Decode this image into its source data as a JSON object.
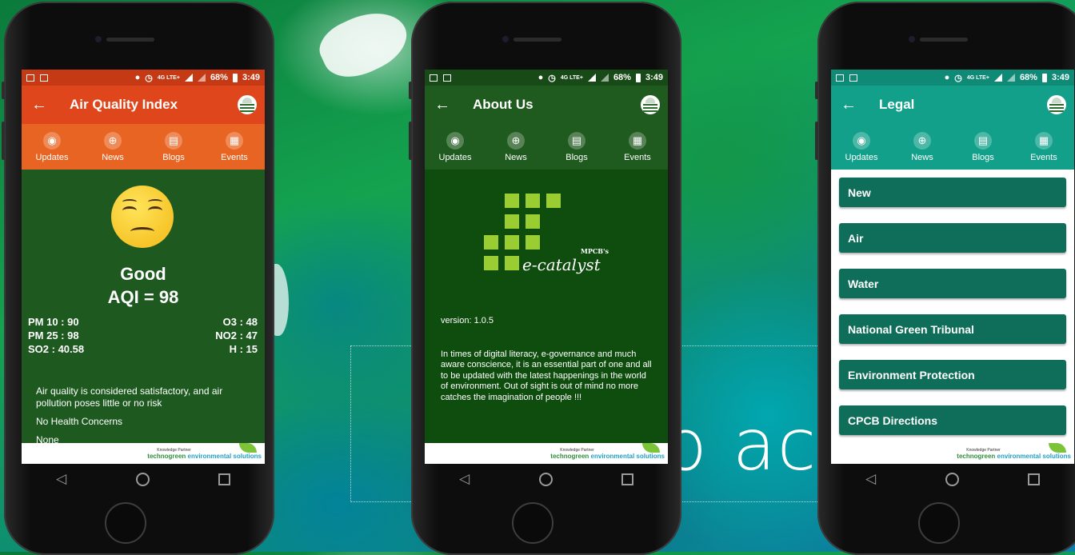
{
  "background": {
    "text": "o ac"
  },
  "status_bar": {
    "network": "4G LTE+",
    "battery": "68%",
    "time": "3:49"
  },
  "footer": {
    "partner_label": "Knowledge Partner",
    "partner_name_1": "technogreen",
    "partner_name_2": "environmental solutions"
  },
  "tabs": [
    {
      "label": "Updates",
      "icon": "updates-icon"
    },
    {
      "label": "News",
      "icon": "globe-icon"
    },
    {
      "label": "Blogs",
      "icon": "blog-icon"
    },
    {
      "label": "Events",
      "icon": "calendar-icon"
    }
  ],
  "screens": {
    "aqi": {
      "title": "Air Quality Index",
      "colors": {
        "appbar": "#e0461b",
        "tabbar": "#e86422",
        "body": "#1e5a20",
        "status": "#c53a15"
      },
      "status": "Good",
      "aqi_value": "AQI = 98",
      "pollutants_left": [
        "PM 10 : 90",
        "PM 25 : 98",
        "SO2 : 40.58"
      ],
      "pollutants_right": [
        "O3 : 48",
        "NO2 : 47",
        "H : 15"
      ],
      "description": "Air quality is considered satisfactory, and air pollution poses little or no risk",
      "health": "No Health Concerns",
      "cautionary": "None"
    },
    "about": {
      "title": "About Us",
      "colors": {
        "appbar": "#1f5a1f",
        "tabbar": "#1f5a1f",
        "body": "#0f4d0f",
        "status": "#184a18"
      },
      "logo_prefix": "MPCB's",
      "logo_text": "e-catalyst",
      "version": "version: 1.0.5",
      "text": "In times of digital literacy, e-governance and much aware conscience, it is an essential part of one and all to be updated with the latest happenings in the world of environment. Out of sight is out of mind no more catches the imagination of people !!!"
    },
    "legal": {
      "title": "Legal",
      "colors": {
        "appbar": "#12a08a",
        "tabbar": "#12a08a",
        "body": "#ffffff",
        "item": "#0f6e5a",
        "status": "#0e8a76"
      },
      "items": [
        "New",
        "Air",
        "Water",
        "National Green Tribunal",
        "Environment Protection",
        "CPCB Directions"
      ]
    }
  }
}
